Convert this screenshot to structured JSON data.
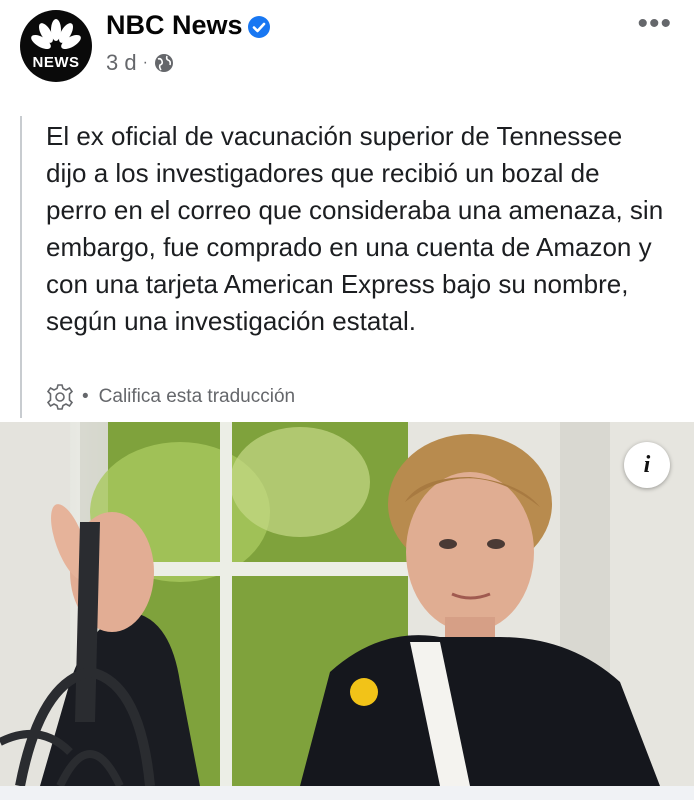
{
  "header": {
    "page_name": "NBC News",
    "avatar_text": "NEWS",
    "timestamp": "3 d",
    "separator": "·",
    "audience_icon": "globe-icon",
    "verified_icon": "verified-badge-icon",
    "more_icon": "more-options-icon",
    "more_label": "•••"
  },
  "post": {
    "text": "El ex oficial de vacunación superior de Tennessee dijo a los investigadores que recibió un bozal de perro en el correo que consideraba una amenaza, sin embargo, fue comprado en una cuenta de Amazon y con una tarjeta American Express bajo su nombre, según una investigación estatal.",
    "translation_separator": "•",
    "translation_label": "Califica esta traducción",
    "translation_icon": "gear-icon"
  },
  "photo": {
    "info_label": "i",
    "info_icon": "info-icon"
  },
  "colors": {
    "accent": "#1877f2",
    "secondary_text": "#65676b",
    "primary_text": "#050505"
  }
}
